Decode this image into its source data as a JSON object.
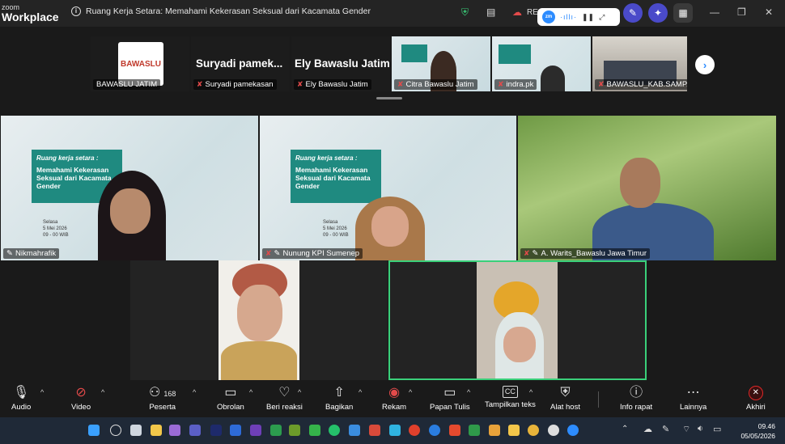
{
  "app": {
    "brand_small": "zoom",
    "brand_big": "Workplace",
    "meeting_title": "Ruang Kerja Setara: Memahami Kekerasan Seksual dari Kacamata Gender",
    "rec_label": "RE",
    "zm_logo": "zm"
  },
  "strip": {
    "tiles": [
      {
        "name": "BAWASLU JATIM",
        "logo": "BAWASLU",
        "muted": false
      },
      {
        "name": "Suryadi pamekasan",
        "big": "Suryadi  pamek...",
        "muted": true
      },
      {
        "name": "Ely Bawaslu Jatim",
        "big": "Ely Bawaslu Jatim",
        "muted": true
      },
      {
        "name": "Citra Bawaslu Jatim",
        "muted": true
      },
      {
        "name": "indra.pk",
        "muted": true
      },
      {
        "name": "BAWASLU_KAB.SAMPA...",
        "muted": true
      }
    ]
  },
  "main": {
    "tiles": [
      {
        "name": "Nikmahrafik"
      },
      {
        "name": "Nunung KPI Sumenep"
      },
      {
        "name": "A. Warits_Bawaslu Jawa Timur"
      }
    ],
    "slide": {
      "heading": "Ruang kerja setara :",
      "body": "Memahami Kekerasan Seksual dari Kacamata Gender",
      "day": "Selasa",
      "date": "5 Mei 2026",
      "time": "09 - 00 WIB"
    }
  },
  "toolbar": {
    "audio": "Audio",
    "video": "Video",
    "participants": "Peserta",
    "participants_count": "168",
    "chat": "Obrolan",
    "reactions": "Beri reaksi",
    "share": "Bagikan",
    "record": "Rekam",
    "whiteboard": "Papan Tulis",
    "captions": "Tampilkan teks",
    "host_tools": "Alat host",
    "meeting_info": "Info rapat",
    "more": "Lainnya",
    "end": "Akhiri",
    "cc": "CC"
  },
  "taskbar": {
    "time": "09.46",
    "date": "05/05/2026"
  },
  "colors": {
    "accent": "#2d8cff",
    "teal": "#1f8a80",
    "end": "#e02828",
    "active_border": "#3ad07a"
  }
}
